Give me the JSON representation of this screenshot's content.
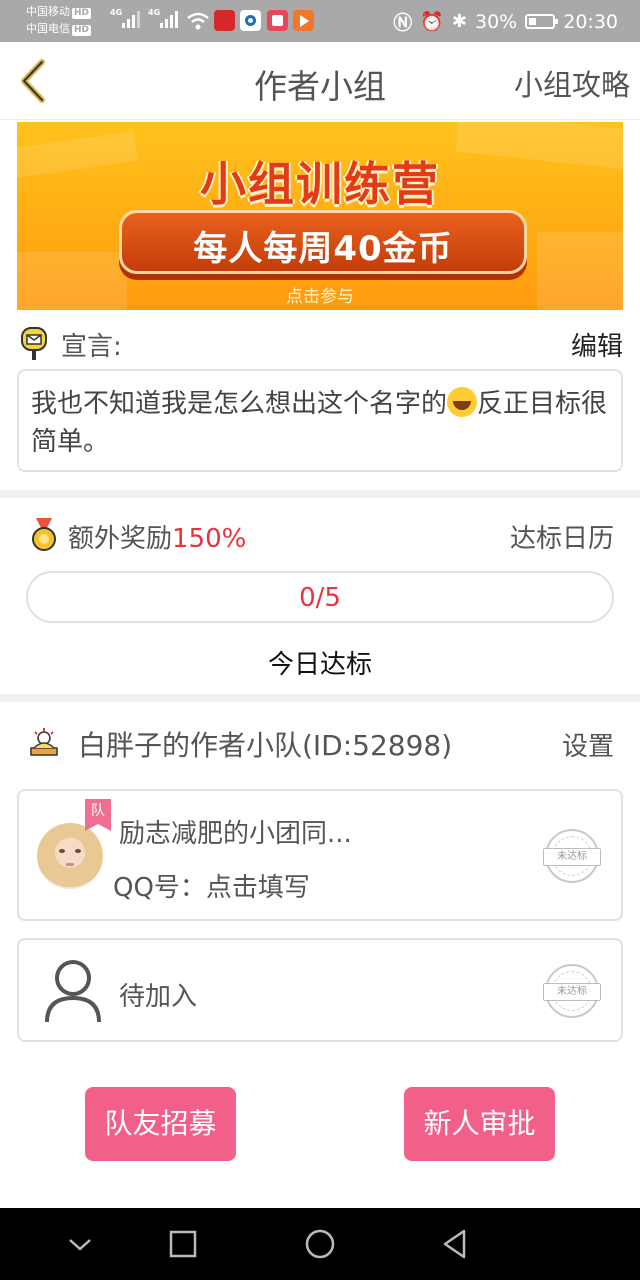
{
  "status_bar": {
    "carrier1": "中国移动",
    "carrier2": "中国电信",
    "hd_badge": "HD",
    "network": "4G",
    "battery": "30%",
    "time": "20:30"
  },
  "header": {
    "title": "作者小组",
    "guide_link": "小组攻略"
  },
  "banner": {
    "title": "小组训练营",
    "subtitle": "每人每周40金币",
    "cta": "点击参与"
  },
  "declaration": {
    "label": "宣言:",
    "edit_label": "编辑",
    "text_before_emoji": "我也不知道我是怎么想出这个名字的",
    "text_after_emoji": "反正目标很简单。"
  },
  "reward": {
    "label": "额外奖励",
    "value": "150%",
    "calendar_link": "达标日历",
    "progress_text": "0/5",
    "progress_fraction": 0,
    "today_label": "今日达标"
  },
  "team": {
    "name": "白胖子的作者小队(ID:52898)",
    "settings_label": "设置",
    "members": [
      {
        "name": "励志减肥的小团同...",
        "qq": "QQ号：点击填写",
        "badge": "队",
        "stamp": "未达标"
      },
      {
        "name": "待加入",
        "stamp": "未达标"
      }
    ]
  },
  "actions": {
    "recruit": "队友招募",
    "approve": "新人审批"
  },
  "colors": {
    "accent_pink": "#f2608a",
    "reward_red": "#e8323c",
    "banner_orange": "#ffad14"
  }
}
